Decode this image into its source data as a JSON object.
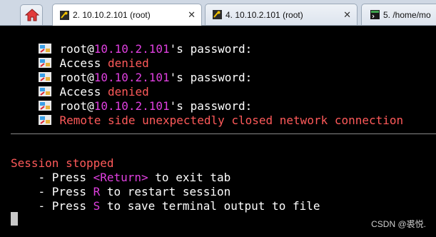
{
  "tabs": [
    {
      "label": "2. 10.10.2.101 (root)",
      "active": true,
      "icon": "terminal-key-icon"
    },
    {
      "label": "4. 10.10.2.101 (root)",
      "active": false,
      "icon": "terminal-key-icon"
    },
    {
      "label": "5. /home/mo",
      "active": false,
      "icon": "local-terminal-icon"
    }
  ],
  "home_icon": "home-icon",
  "close_glyph": "✕",
  "terminal": {
    "lines": [
      {
        "a": "root@",
        "b": "10.10.2.101",
        "c": "'s password:"
      },
      {
        "a": "Access ",
        "b": "denied"
      },
      {
        "a": "root@",
        "b": "10.10.2.101",
        "c": "'s password:"
      },
      {
        "a": "Access ",
        "b": "denied"
      },
      {
        "a": "root@",
        "b": "10.10.2.101",
        "c": "'s password:"
      },
      {
        "a": "Remote side unexpectedly closed network connection"
      }
    ],
    "session_stopped": "Session stopped",
    "options": [
      {
        "pre": "    - Press ",
        "key": "<Return>",
        "post": " to exit tab"
      },
      {
        "pre": "    - Press ",
        "key": "R",
        "post": " to restart session"
      },
      {
        "pre": "    - Press ",
        "key": "S",
        "post": " to save terminal output to file"
      }
    ]
  },
  "colors": {
    "host": "#e040e0",
    "error": "#ff5a5a",
    "text": "#ffffff",
    "background": "#000000"
  },
  "watermark": "CSDN @裘悦."
}
